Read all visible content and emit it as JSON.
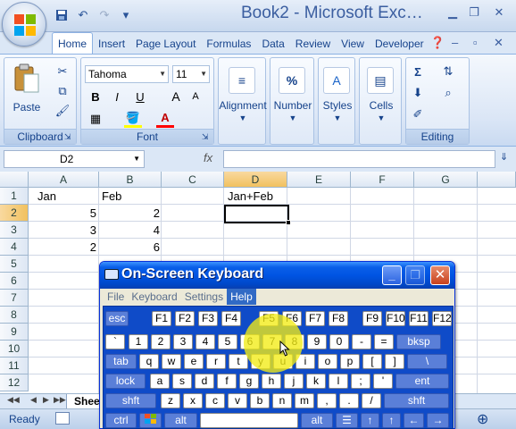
{
  "window": {
    "title": "Book2 - Microsoft Exc…",
    "colors": {
      "ribbon": "#dbe6f6",
      "accent": "#15428b",
      "osk_blue": "#0054e3",
      "highlight": "#f2ec14"
    }
  },
  "quick_access": [
    "save-icon",
    "undo-icon",
    "redo-icon",
    "customize-icon"
  ],
  "ribbon_tabs": [
    "Home",
    "Insert",
    "Page Layout",
    "Formulas",
    "Data",
    "Review",
    "View",
    "Developer"
  ],
  "ribbon": {
    "clipboard": {
      "paste_label": "Paste",
      "group_label": "Clipboard"
    },
    "font": {
      "font_name": "Tahoma",
      "font_size": "11",
      "bold": "B",
      "italic": "I",
      "underline": "U",
      "grow": "A",
      "shrink": "A",
      "font_color_letter": "A",
      "group_label": "Font"
    },
    "alignment": {
      "label": "Alignment"
    },
    "number": {
      "label": "Number",
      "icon_text": "%"
    },
    "styles": {
      "label": "Styles"
    },
    "cells": {
      "label": "Cells"
    },
    "editing": {
      "group_label": "Editing",
      "sum_symbol": "Σ"
    }
  },
  "formula_bar": {
    "name_box": "D2",
    "fx": "fx",
    "formula": ""
  },
  "columns": [
    "A",
    "B",
    "C",
    "D",
    "E",
    "F",
    "G"
  ],
  "selected_column": "D",
  "rows": [
    "1",
    "2",
    "3",
    "4",
    "5",
    "6",
    "7",
    "8",
    "9",
    "10",
    "11",
    "12"
  ],
  "selected_row": "2",
  "cells": {
    "A1": "Jan",
    "B1": "Feb",
    "D1": "Jan+Feb",
    "A2": "5",
    "B2": "2",
    "A3": "3",
    "B3": "4",
    "A4": "2",
    "B4": "6"
  },
  "sheet_tab": "Shee",
  "status": {
    "ready": "Ready"
  },
  "osk": {
    "title": "On-Screen Keyboard",
    "menu": [
      "File",
      "Keyboard",
      "Settings",
      "Help"
    ],
    "menu_highlighted": "Help",
    "rows": [
      [
        "esc",
        "F1",
        "F2",
        "F3",
        "F4",
        "F5",
        "F6",
        "F7",
        "F8",
        "F9",
        "F10",
        "F11",
        "F12"
      ],
      [
        "`",
        "1",
        "2",
        "3",
        "4",
        "5",
        "6",
        "7",
        "8",
        "9",
        "0",
        "-",
        "=",
        "bksp"
      ],
      [
        "tab",
        "q",
        "w",
        "e",
        "r",
        "t",
        "y",
        "u",
        "i",
        "o",
        "p",
        "[",
        "]",
        "\\"
      ],
      [
        "lock",
        "a",
        "s",
        "d",
        "f",
        "g",
        "h",
        "j",
        "k",
        "l",
        ";",
        "'",
        "ent"
      ],
      [
        "shft",
        "z",
        "x",
        "c",
        "v",
        "b",
        "n",
        "m",
        ",",
        ".",
        "/",
        "shft"
      ],
      [
        "ctrl",
        "win",
        "alt",
        "space",
        "alt",
        "menu",
        "↑",
        "↑",
        "←",
        "→"
      ]
    ]
  }
}
